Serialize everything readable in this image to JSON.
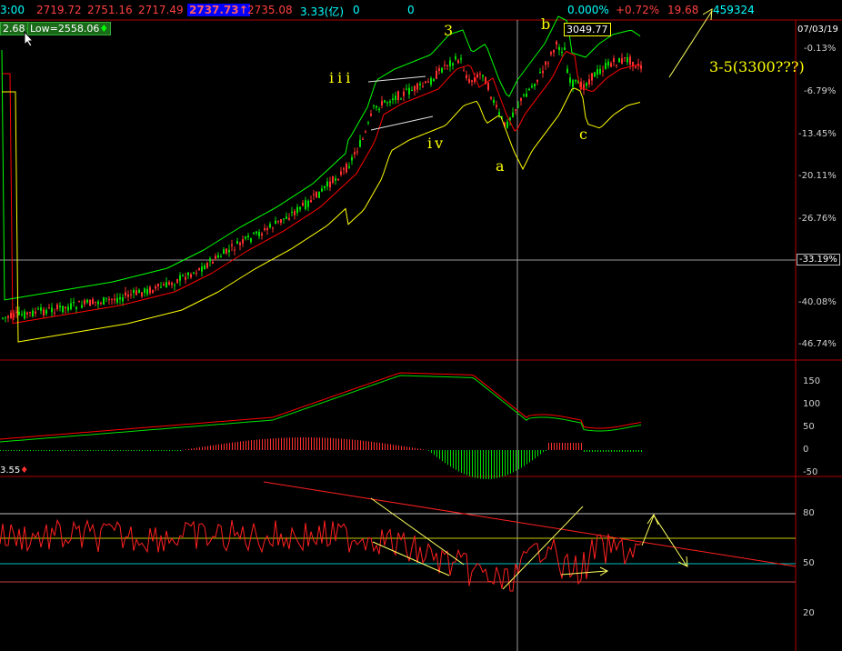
{
  "header": {
    "time": "3:00",
    "open": "2719.72",
    "high": "2751.16",
    "low": "2717.49",
    "close": "2737.73",
    "close_arrow": "↑",
    "avg": "2735.08",
    "amount": "3.33(亿)",
    "v1": "0",
    "v2": "0",
    "pct0": "0.000%",
    "chg": "+0.72%",
    "amp": "19.68",
    "vol": "459324"
  },
  "toolbar": {
    "hi_label": "2.68",
    "low_label": "Low=2558.06"
  },
  "price_axis": {
    "date": "07/03/19",
    "ticks": [
      "-0.13%",
      "-6.79%",
      "-13.45%",
      "-20.11%",
      "-26.76%",
      "-33.19%",
      "-40.08%",
      "-46.74%"
    ],
    "cursor_value": "-33.19%",
    "high_tag": "3049.77"
  },
  "wave_labels": {
    "iii": "iii",
    "three": "3",
    "b": "b",
    "iv": "iv",
    "a": "a",
    "c": "c",
    "target": "3-5(3300???)"
  },
  "macd_axis": {
    "ticks": [
      "150",
      "100",
      "50",
      "0",
      "-50"
    ]
  },
  "rsi_axis": {
    "ticks": [
      "80",
      "50",
      "20"
    ],
    "label": "3.55"
  },
  "colors": {
    "up": "#ff3030",
    "down": "#00e000",
    "ma": "#ff0000",
    "band_upper": "#00ff00",
    "band_lower": "#ffff00",
    "grid": "#808080",
    "header_value": "#ff4040",
    "header_highlight_bg": "#0000ff"
  }
}
